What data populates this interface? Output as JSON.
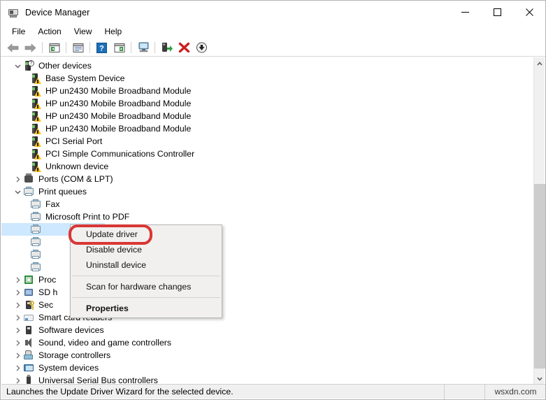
{
  "window": {
    "title": "Device Manager",
    "title_icon": "device-manager-icon",
    "minimize_label": "Minimize",
    "maximize_label": "Maximize",
    "close_label": "Close"
  },
  "menubar": {
    "items": [
      {
        "label": "File"
      },
      {
        "label": "Action"
      },
      {
        "label": "View"
      },
      {
        "label": "Help"
      }
    ]
  },
  "toolbar": {
    "buttons": [
      {
        "name": "back-icon",
        "tooltip": "Back"
      },
      {
        "name": "forward-icon",
        "tooltip": "Forward"
      },
      {
        "name": "show-hide-console-tree-icon",
        "tooltip": "Show/Hide Console Tree"
      },
      {
        "name": "properties-icon",
        "tooltip": "Properties"
      },
      {
        "name": "help-icon",
        "tooltip": "Help"
      },
      {
        "name": "show-hide-action-pane-icon",
        "tooltip": "Show/Hide Action Pane"
      },
      {
        "name": "scan-for-hardware-changes-icon",
        "tooltip": "Scan for hardware changes"
      },
      {
        "name": "update-driver-icon",
        "tooltip": "Update driver"
      },
      {
        "name": "uninstall-device-icon",
        "tooltip": "Uninstall device"
      },
      {
        "name": "disable-device-icon",
        "tooltip": "Disable device"
      }
    ]
  },
  "tree": {
    "rows": [
      {
        "label": "Other devices",
        "icon": "other-devices-icon",
        "indent": 1,
        "chevron": "expanded"
      },
      {
        "label": "Base System Device",
        "icon": "unknown-device-warning-icon",
        "indent": 2,
        "chevron": "none"
      },
      {
        "label": "HP un2430 Mobile Broadband Module",
        "icon": "unknown-device-warning-icon",
        "indent": 2,
        "chevron": "none"
      },
      {
        "label": "HP un2430 Mobile Broadband Module",
        "icon": "unknown-device-warning-icon",
        "indent": 2,
        "chevron": "none"
      },
      {
        "label": "HP un2430 Mobile Broadband Module",
        "icon": "unknown-device-warning-icon",
        "indent": 2,
        "chevron": "none"
      },
      {
        "label": "HP un2430 Mobile Broadband Module",
        "icon": "unknown-device-warning-icon",
        "indent": 2,
        "chevron": "none"
      },
      {
        "label": "PCI Serial Port",
        "icon": "unknown-device-warning-icon",
        "indent": 2,
        "chevron": "none"
      },
      {
        "label": "PCI Simple Communications Controller",
        "icon": "unknown-device-warning-icon",
        "indent": 2,
        "chevron": "none"
      },
      {
        "label": "Unknown device",
        "icon": "unknown-device-warning-icon",
        "indent": 2,
        "chevron": "none"
      },
      {
        "label": "Ports (COM & LPT)",
        "icon": "ports-icon",
        "indent": 1,
        "chevron": "collapsed"
      },
      {
        "label": "Print queues",
        "icon": "printer-icon",
        "indent": 1,
        "chevron": "expanded"
      },
      {
        "label": "Fax",
        "icon": "printer-icon",
        "indent": 2,
        "chevron": "none"
      },
      {
        "label": "Microsoft Print to PDF",
        "icon": "printer-icon",
        "indent": 2,
        "chevron": "none"
      },
      {
        "label": "",
        "icon": "printer-icon",
        "indent": 2,
        "chevron": "none",
        "selected": true
      },
      {
        "label": "",
        "icon": "printer-icon",
        "indent": 2,
        "chevron": "none"
      },
      {
        "label": "",
        "icon": "printer-icon",
        "indent": 2,
        "chevron": "none"
      },
      {
        "label": "",
        "icon": "printer-icon",
        "indent": 2,
        "chevron": "none"
      },
      {
        "label": "Proc",
        "icon": "processors-icon",
        "indent": 1,
        "chevron": "collapsed"
      },
      {
        "label": "SD h",
        "icon": "sd-host-adapters-icon",
        "indent": 1,
        "chevron": "collapsed"
      },
      {
        "label": "Sec",
        "icon": "security-devices-icon",
        "indent": 1,
        "chevron": "collapsed"
      },
      {
        "label": "Smart card readers",
        "icon": "smart-card-readers-icon",
        "indent": 1,
        "chevron": "collapsed"
      },
      {
        "label": "Software devices",
        "icon": "software-devices-icon",
        "indent": 1,
        "chevron": "collapsed"
      },
      {
        "label": "Sound, video and game controllers",
        "icon": "sound-controllers-icon",
        "indent": 1,
        "chevron": "collapsed"
      },
      {
        "label": "Storage controllers",
        "icon": "storage-controllers-icon",
        "indent": 1,
        "chevron": "collapsed"
      },
      {
        "label": "System devices",
        "icon": "system-devices-icon",
        "indent": 1,
        "chevron": "collapsed"
      },
      {
        "label": "Universal Serial Bus controllers",
        "icon": "usb-controllers-icon",
        "indent": 1,
        "chevron": "collapsed"
      }
    ]
  },
  "context_menu": {
    "items": [
      {
        "label": "Update driver",
        "type": "item",
        "highlighted": true
      },
      {
        "label": "Disable device",
        "type": "item"
      },
      {
        "label": "Uninstall device",
        "type": "item"
      },
      {
        "type": "separator"
      },
      {
        "label": "Scan for hardware changes",
        "type": "item"
      },
      {
        "type": "separator"
      },
      {
        "label": "Properties",
        "type": "item",
        "bold": true
      }
    ],
    "highlight_color": "#d93636"
  },
  "statusbar": {
    "text": "Launches the Update Driver Wizard for the selected device.",
    "watermark": "wsxdn.com"
  },
  "colors": {
    "selection": "#cde8ff",
    "menu_bg": "#f1f0ef",
    "status_bg": "#f0f0f0",
    "warning_yellow": "#ffc20e",
    "accent_red": "#d93636"
  }
}
